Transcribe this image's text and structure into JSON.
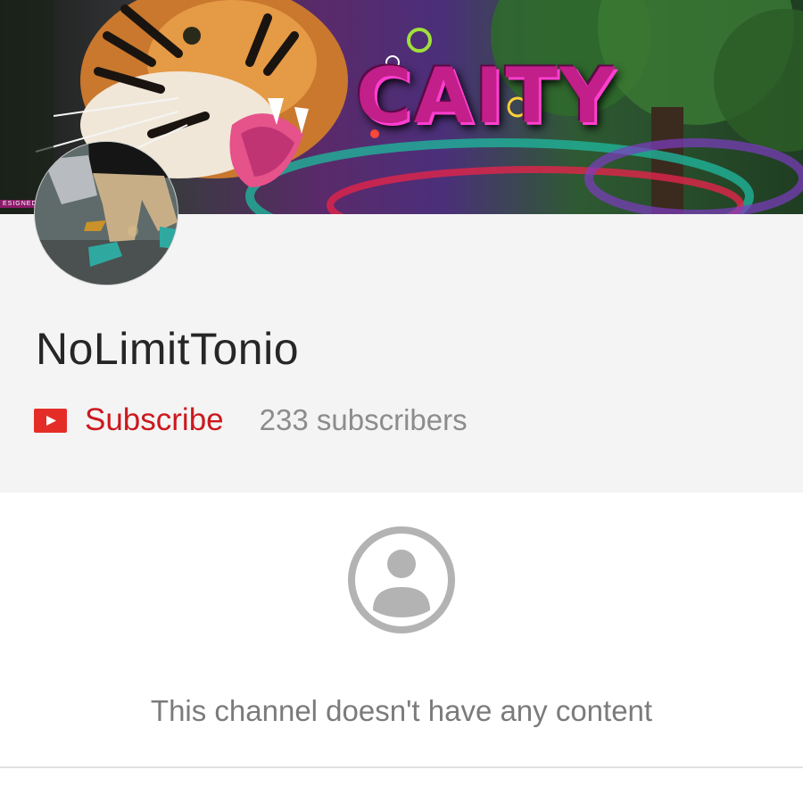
{
  "banner": {
    "art_text": "CAITY",
    "corner_tag": "ESIGNED"
  },
  "channel": {
    "name": "NoLimitTonio",
    "subscribe_label": "Subscribe",
    "subscriber_count": "233 subscribers"
  },
  "empty_state": {
    "message": "This channel doesn't have any content"
  },
  "colors": {
    "subscribe_red": "#cc181e",
    "header_bg": "#f4f4f4",
    "muted_text": "#8c8c8c",
    "empty_icon": "#b3b3b3"
  },
  "icons": {
    "subscribe": "youtube-play-icon",
    "empty": "account-circle-icon"
  }
}
